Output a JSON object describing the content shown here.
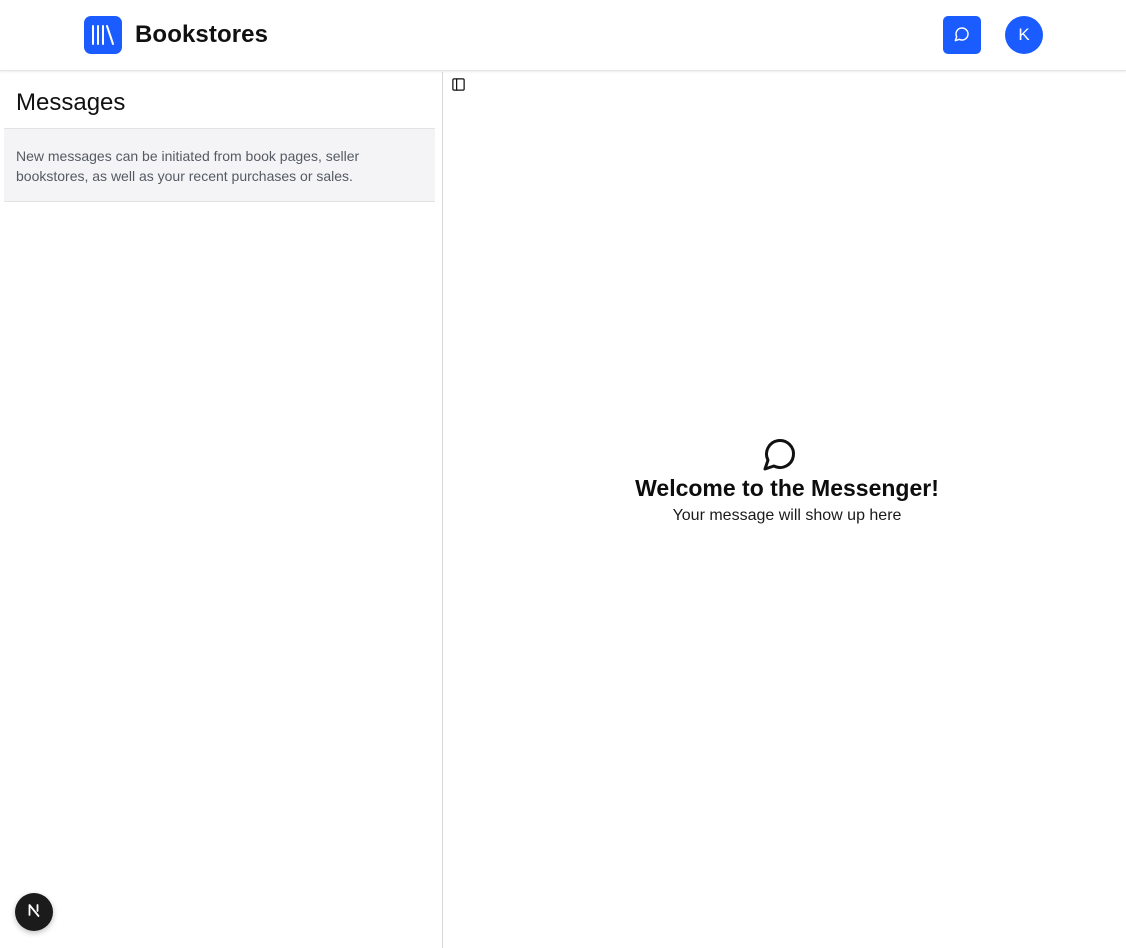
{
  "header": {
    "brand": "Bookstores",
    "avatar_initial": "K"
  },
  "sidebar": {
    "title": "Messages",
    "info_text": "New messages can be initiated from book pages, seller bookstores, as well as your recent purchases or sales."
  },
  "main": {
    "welcome_title": "Welcome to the Messenger!",
    "welcome_subtitle": "Your message will show up here"
  },
  "icons": {
    "logo": "books-icon",
    "header_button": "chat-bubble-icon",
    "sidebar_toggle": "sidebar-panel-icon",
    "empty_state": "chat-bubble-icon",
    "badge": "nextjs-icon"
  },
  "colors": {
    "accent": "#1a5cff",
    "sidebar_info_bg": "#f4f4f6",
    "badge_bg": "#1b1b1b"
  }
}
